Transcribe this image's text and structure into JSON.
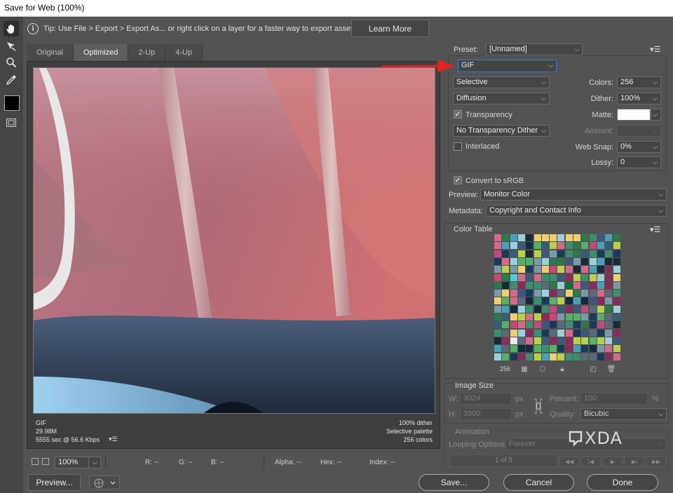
{
  "window": {
    "title": "Save for Web (100%)"
  },
  "tip": {
    "text": "Tip: Use File > Export > Export As...  or right click on a layer for a faster way to export assets",
    "learn_more": "Learn More"
  },
  "tools": [
    {
      "name": "hand-tool",
      "icon": "hand-icon"
    },
    {
      "name": "slice-select-tool",
      "icon": "slice-select-icon"
    },
    {
      "name": "zoom-tool",
      "icon": "magnifier-icon"
    },
    {
      "name": "eyedropper-tool",
      "icon": "eyedropper-icon"
    },
    {
      "name": "eyedropper-color",
      "icon": "color-swatch"
    },
    {
      "name": "toggle-slices",
      "icon": "slices-visibility-icon"
    }
  ],
  "tabs": [
    "Original",
    "Optimized",
    "2-Up",
    "4-Up"
  ],
  "active_tab": "Optimized",
  "image_info": {
    "format": "GIF",
    "size": "29.98M",
    "time": "5555 sec @ 56.6 Kbps",
    "dither": "100% dither",
    "palette": "Selective palette",
    "colors": "256 colors"
  },
  "status": {
    "zoom": "100%",
    "r": "R: --",
    "g": "G: --",
    "b": "B: --",
    "alpha": "Alpha: --",
    "hex": "Hex: --",
    "index": "Index: --"
  },
  "bottom_buttons": {
    "preview": "Preview...",
    "save": "Save...",
    "cancel": "Cancel",
    "done": "Done"
  },
  "settings": {
    "preset_label": "Preset:",
    "preset_value": "[Unnamed]",
    "format": "GIF",
    "reduction": "Selective",
    "dither_algorithm": "Diffusion",
    "transparency_label": "Transparency",
    "transparency_checked": true,
    "transparency_dither": "No Transparency Dither",
    "interlaced_label": "Interlaced",
    "interlaced_checked": false,
    "colors_label": "Colors:",
    "colors_value": "256",
    "dither_label": "Dither:",
    "dither_value": "100%",
    "matte_label": "Matte:",
    "amount_label": "Amount:",
    "websnap_label": "Web Snap:",
    "websnap_value": "0%",
    "lossy_label": "Lossy:",
    "lossy_value": "0",
    "convert_label": "Convert to sRGB",
    "convert_checked": true,
    "preview_label": "Preview:",
    "preview_value": "Monitor Color",
    "metadata_label": "Metadata:",
    "metadata_value": "Copyright and Contact Info"
  },
  "color_table": {
    "title": "Color Table",
    "count": "256"
  },
  "image_size": {
    "title": "Image Size",
    "w_label": "W:",
    "w_value": "3024",
    "h_label": "H:",
    "h_value": "3800",
    "unit": "px",
    "percent_label": "Percent:",
    "percent_value": "100",
    "percent_unit": "%",
    "quality_label": "Quality:",
    "quality_value": "Bicubic"
  },
  "animation": {
    "title": "Animation",
    "looping_label": "Looping Options:",
    "looping_value": "Forever",
    "frame": "1 of 5"
  },
  "watermark": "XDA",
  "colors": {
    "annotation_arrow": "#e8201f",
    "focus_border": "#3a78d6",
    "panel_bg": "#535353"
  }
}
